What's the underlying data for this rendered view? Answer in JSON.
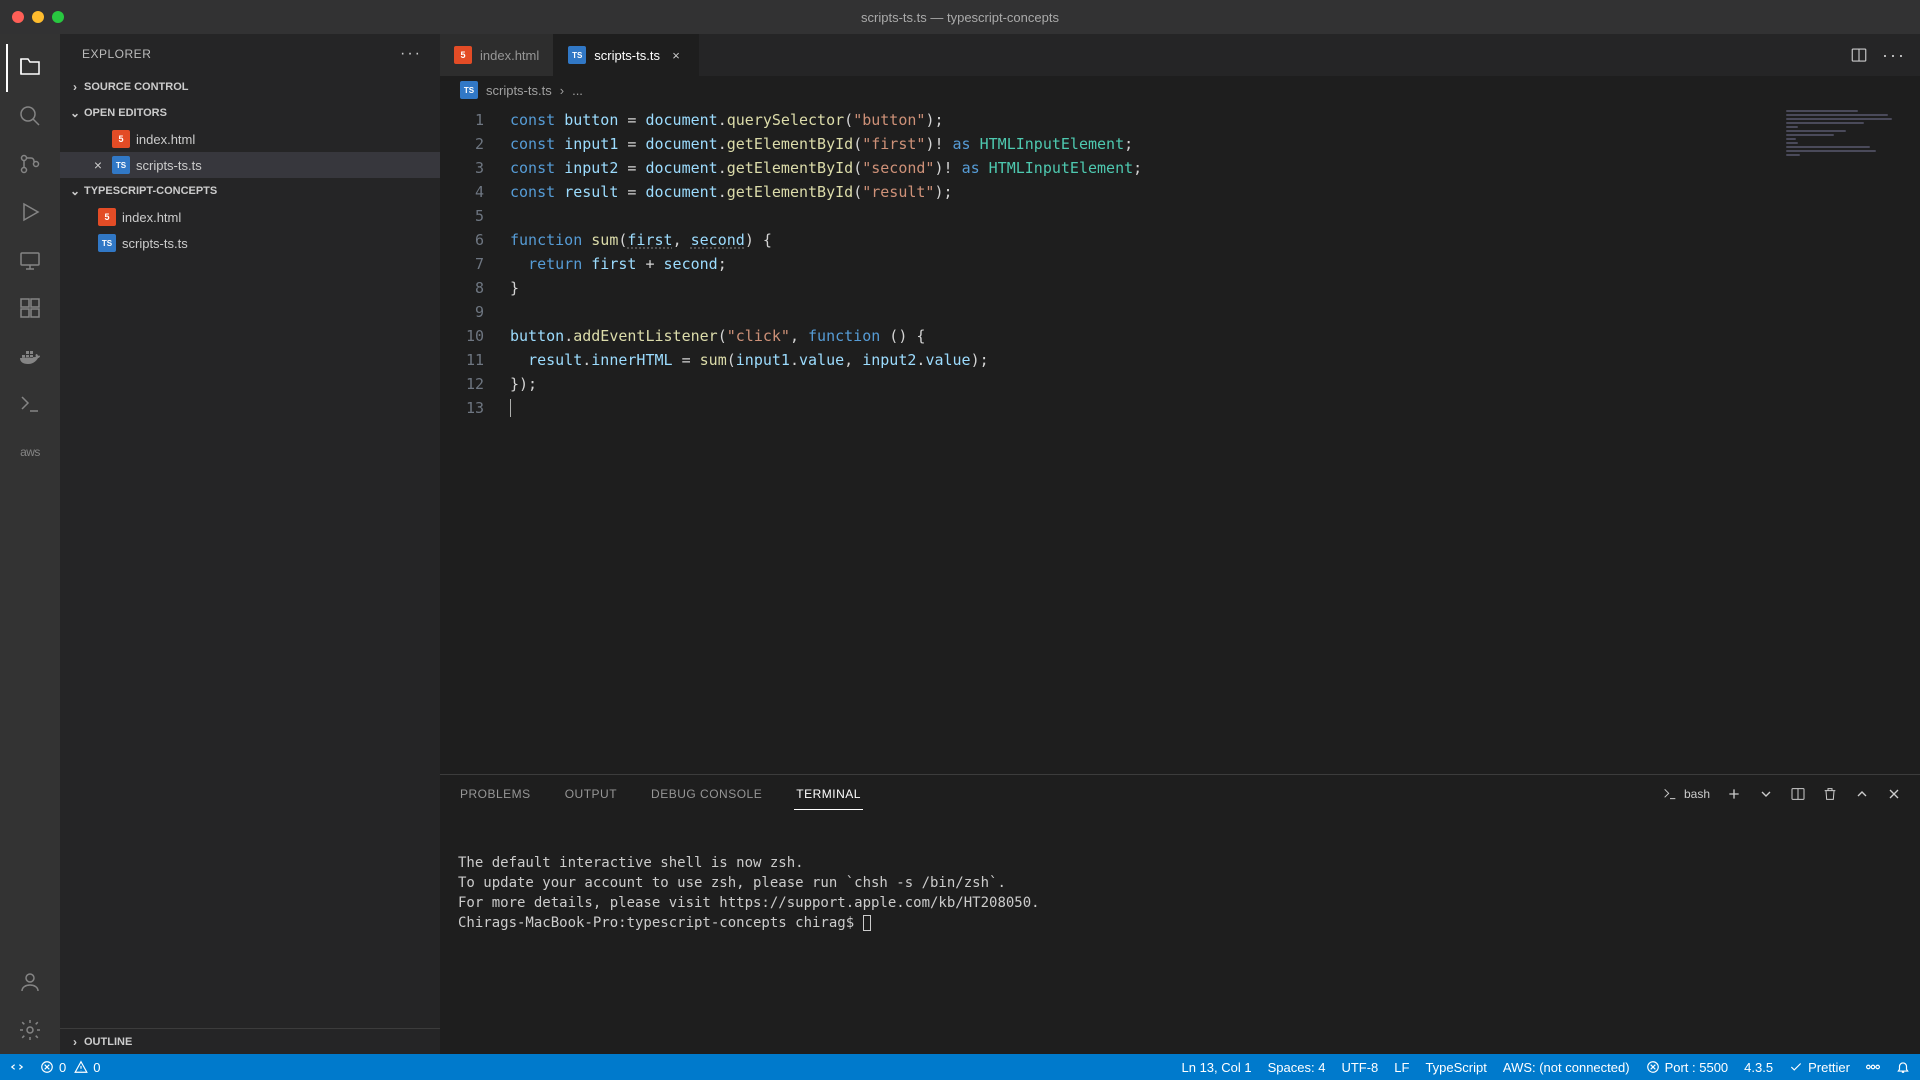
{
  "title": "scripts-ts.ts — typescript-concepts",
  "sidebar": {
    "header": "EXPLORER",
    "sections": {
      "source_control": "SOURCE CONTROL",
      "open_editors": "OPEN EDITORS",
      "project": "TYPESCRIPT-CONCEPTS",
      "outline": "OUTLINE"
    },
    "open_editors": [
      {
        "name": "index.html",
        "type": "html",
        "active": false
      },
      {
        "name": "scripts-ts.ts",
        "type": "ts",
        "active": true
      }
    ],
    "files": [
      {
        "name": "index.html",
        "type": "html"
      },
      {
        "name": "scripts-ts.ts",
        "type": "ts"
      }
    ]
  },
  "tabs": [
    {
      "name": "index.html",
      "type": "html",
      "active": false,
      "closable": false
    },
    {
      "name": "scripts-ts.ts",
      "type": "ts",
      "active": true,
      "closable": true
    }
  ],
  "breadcrumb": {
    "file": "scripts-ts.ts",
    "rest": "..."
  },
  "code_lines": [
    {
      "n": 1,
      "tokens": [
        [
          "kw",
          "const"
        ],
        [
          "op",
          " "
        ],
        [
          "var",
          "button"
        ],
        [
          "op",
          " = "
        ],
        [
          "var",
          "document"
        ],
        [
          "op",
          "."
        ],
        [
          "fn",
          "querySelector"
        ],
        [
          "op",
          "("
        ],
        [
          "str",
          "\"button\""
        ],
        [
          "op",
          ");"
        ]
      ]
    },
    {
      "n": 2,
      "tokens": [
        [
          "kw",
          "const"
        ],
        [
          "op",
          " "
        ],
        [
          "var",
          "input1"
        ],
        [
          "op",
          " = "
        ],
        [
          "var",
          "document"
        ],
        [
          "op",
          "."
        ],
        [
          "fn",
          "getElementById"
        ],
        [
          "op",
          "("
        ],
        [
          "str",
          "\"first\""
        ],
        [
          "op",
          ")! "
        ],
        [
          "kw",
          "as"
        ],
        [
          "op",
          " "
        ],
        [
          "cls",
          "HTMLInputElement"
        ],
        [
          "op",
          ";"
        ]
      ]
    },
    {
      "n": 3,
      "tokens": [
        [
          "kw",
          "const"
        ],
        [
          "op",
          " "
        ],
        [
          "var",
          "input2"
        ],
        [
          "op",
          " = "
        ],
        [
          "var",
          "document"
        ],
        [
          "op",
          "."
        ],
        [
          "fn",
          "getElementById"
        ],
        [
          "op",
          "("
        ],
        [
          "str",
          "\"second\""
        ],
        [
          "op",
          ")! "
        ],
        [
          "kw",
          "as"
        ],
        [
          "op",
          " "
        ],
        [
          "cls",
          "HTMLInputElement"
        ],
        [
          "op",
          ";"
        ]
      ]
    },
    {
      "n": 4,
      "tokens": [
        [
          "kw",
          "const"
        ],
        [
          "op",
          " "
        ],
        [
          "var",
          "result"
        ],
        [
          "op",
          " = "
        ],
        [
          "var",
          "document"
        ],
        [
          "op",
          "."
        ],
        [
          "fn",
          "getElementById"
        ],
        [
          "op",
          "("
        ],
        [
          "str",
          "\"result\""
        ],
        [
          "op",
          ");"
        ]
      ]
    },
    {
      "n": 5,
      "tokens": []
    },
    {
      "n": 6,
      "tokens": [
        [
          "kw",
          "function"
        ],
        [
          "op",
          " "
        ],
        [
          "fn",
          "sum"
        ],
        [
          "op",
          "("
        ],
        [
          "vard",
          "first"
        ],
        [
          "op",
          ", "
        ],
        [
          "vard",
          "second"
        ],
        [
          "op",
          ") {"
        ]
      ]
    },
    {
      "n": 7,
      "tokens": [
        [
          "op",
          "  "
        ],
        [
          "kw",
          "return"
        ],
        [
          "op",
          " "
        ],
        [
          "var",
          "first"
        ],
        [
          "op",
          " + "
        ],
        [
          "var",
          "second"
        ],
        [
          "op",
          ";"
        ]
      ]
    },
    {
      "n": 8,
      "tokens": [
        [
          "op",
          "}"
        ]
      ]
    },
    {
      "n": 9,
      "tokens": []
    },
    {
      "n": 10,
      "tokens": [
        [
          "var",
          "button"
        ],
        [
          "op",
          "."
        ],
        [
          "fn",
          "addEventListener"
        ],
        [
          "op",
          "("
        ],
        [
          "str",
          "\"click\""
        ],
        [
          "op",
          ", "
        ],
        [
          "kw",
          "function"
        ],
        [
          "op",
          " () {"
        ]
      ]
    },
    {
      "n": 11,
      "tokens": [
        [
          "op",
          "  "
        ],
        [
          "var",
          "result"
        ],
        [
          "op",
          "."
        ],
        [
          "var",
          "innerHTML"
        ],
        [
          "op",
          " = "
        ],
        [
          "fn",
          "sum"
        ],
        [
          "op",
          "("
        ],
        [
          "var",
          "input1"
        ],
        [
          "op",
          "."
        ],
        [
          "var",
          "value"
        ],
        [
          "op",
          ", "
        ],
        [
          "var",
          "input2"
        ],
        [
          "op",
          "."
        ],
        [
          "var",
          "value"
        ],
        [
          "op",
          ");"
        ]
      ]
    },
    {
      "n": 12,
      "tokens": [
        [
          "op",
          "});"
        ]
      ]
    },
    {
      "n": 13,
      "tokens": [],
      "cursor": true
    }
  ],
  "panel": {
    "tabs": {
      "problems": "PROBLEMS",
      "output": "OUTPUT",
      "debug_console": "DEBUG CONSOLE",
      "terminal": "TERMINAL"
    },
    "shell": "bash",
    "terminal_lines": [
      "The default interactive shell is now zsh.",
      "To update your account to use zsh, please run `chsh -s /bin/zsh`.",
      "For more details, please visit https://support.apple.com/kb/HT208050."
    ],
    "prompt": "Chirags-MacBook-Pro:typescript-concepts chirag$ "
  },
  "statusbar": {
    "errors": "0",
    "warnings": "0",
    "cursor": "Ln 13, Col 1",
    "spaces": "Spaces: 4",
    "encoding": "UTF-8",
    "eol": "LF",
    "language": "TypeScript",
    "aws": "AWS: (not connected)",
    "port": "Port : 5500",
    "version": "4.3.5",
    "prettier": "Prettier"
  }
}
